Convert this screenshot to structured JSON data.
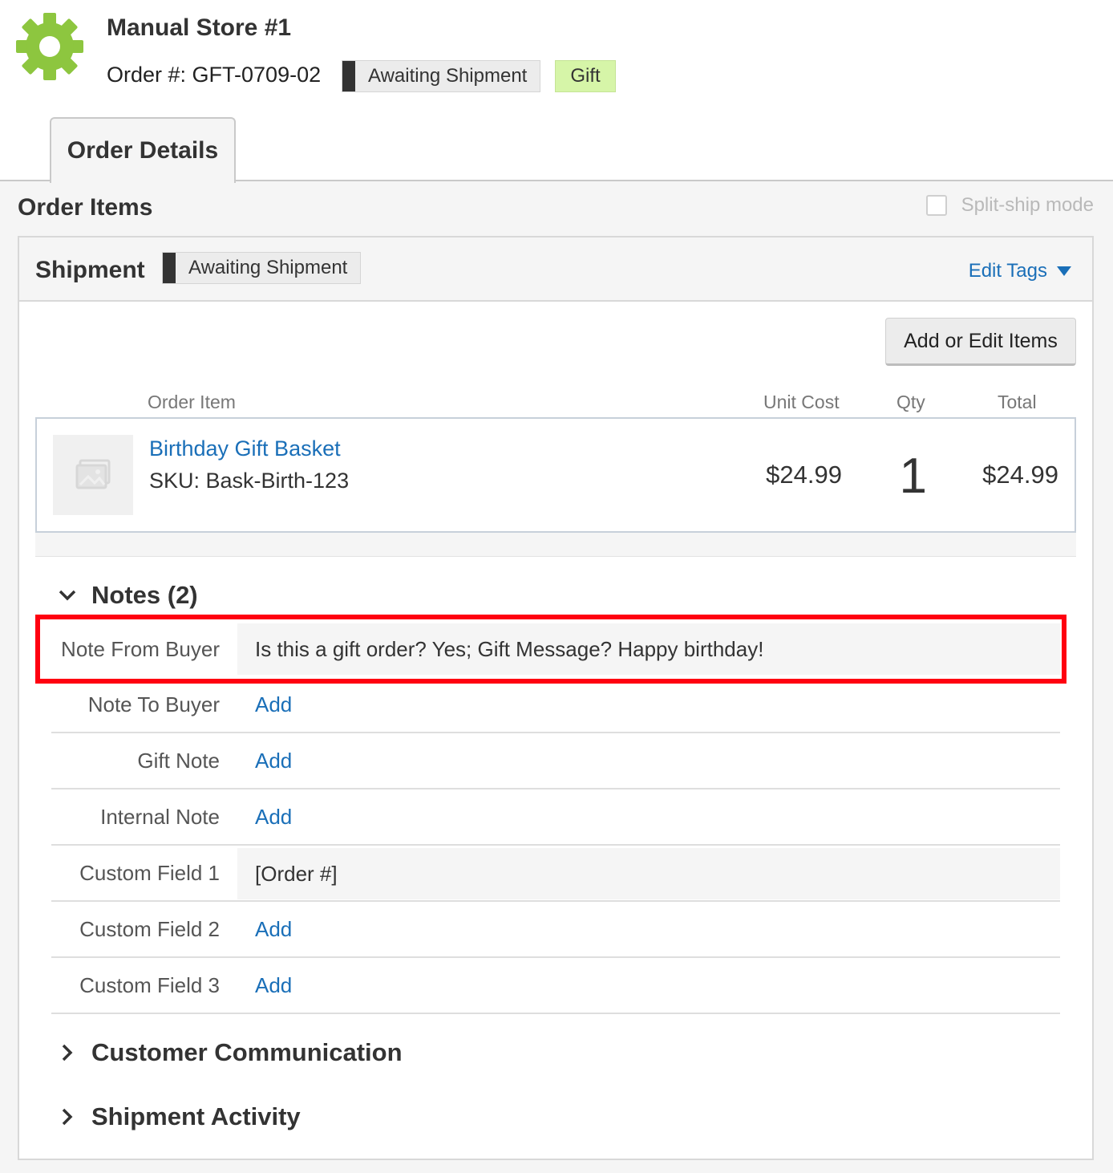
{
  "header": {
    "store_name": "Manual Store #1",
    "order_number": "Order #: GFT-0709-02",
    "status": "Awaiting Shipment",
    "tag": "Gift"
  },
  "tabs": [
    {
      "label": "Order Details"
    }
  ],
  "order_items": {
    "title": "Order Items",
    "split_ship_label": "Split-ship mode"
  },
  "shipment": {
    "title": "Shipment",
    "status": "Awaiting Shipment",
    "edit_tags_label": "Edit Tags",
    "add_edit_button": "Add or Edit Items",
    "columns": {
      "item": "Order Item",
      "unit_cost": "Unit Cost",
      "qty": "Qty",
      "total": "Total"
    },
    "item": {
      "name": "Birthday Gift Basket",
      "sku": "SKU: Bask-Birth-123",
      "unit_cost": "$24.99",
      "qty": "1",
      "total": "$24.99"
    }
  },
  "notes": {
    "title": "Notes (2)",
    "rows": [
      {
        "label": "Note From Buyer",
        "value": "Is this a gift order? Yes; Gift Message? Happy birthday!"
      },
      {
        "label": "Note To Buyer",
        "value": "Add"
      },
      {
        "label": "Gift Note",
        "value": "Add"
      },
      {
        "label": "Internal Note",
        "value": "Add"
      },
      {
        "label": "Custom Field 1",
        "value": "[Order #]"
      },
      {
        "label": "Custom Field 2",
        "value": "Add"
      },
      {
        "label": "Custom Field 3",
        "value": "Add"
      }
    ]
  },
  "sections": {
    "customer_communication": "Customer Communication",
    "shipment_activity": "Shipment Activity"
  },
  "colors": {
    "accent_link": "#1a6fb8",
    "gear": "#8dc63f",
    "gift_tag": "#d6f5a8",
    "highlight": "#ff0010"
  }
}
